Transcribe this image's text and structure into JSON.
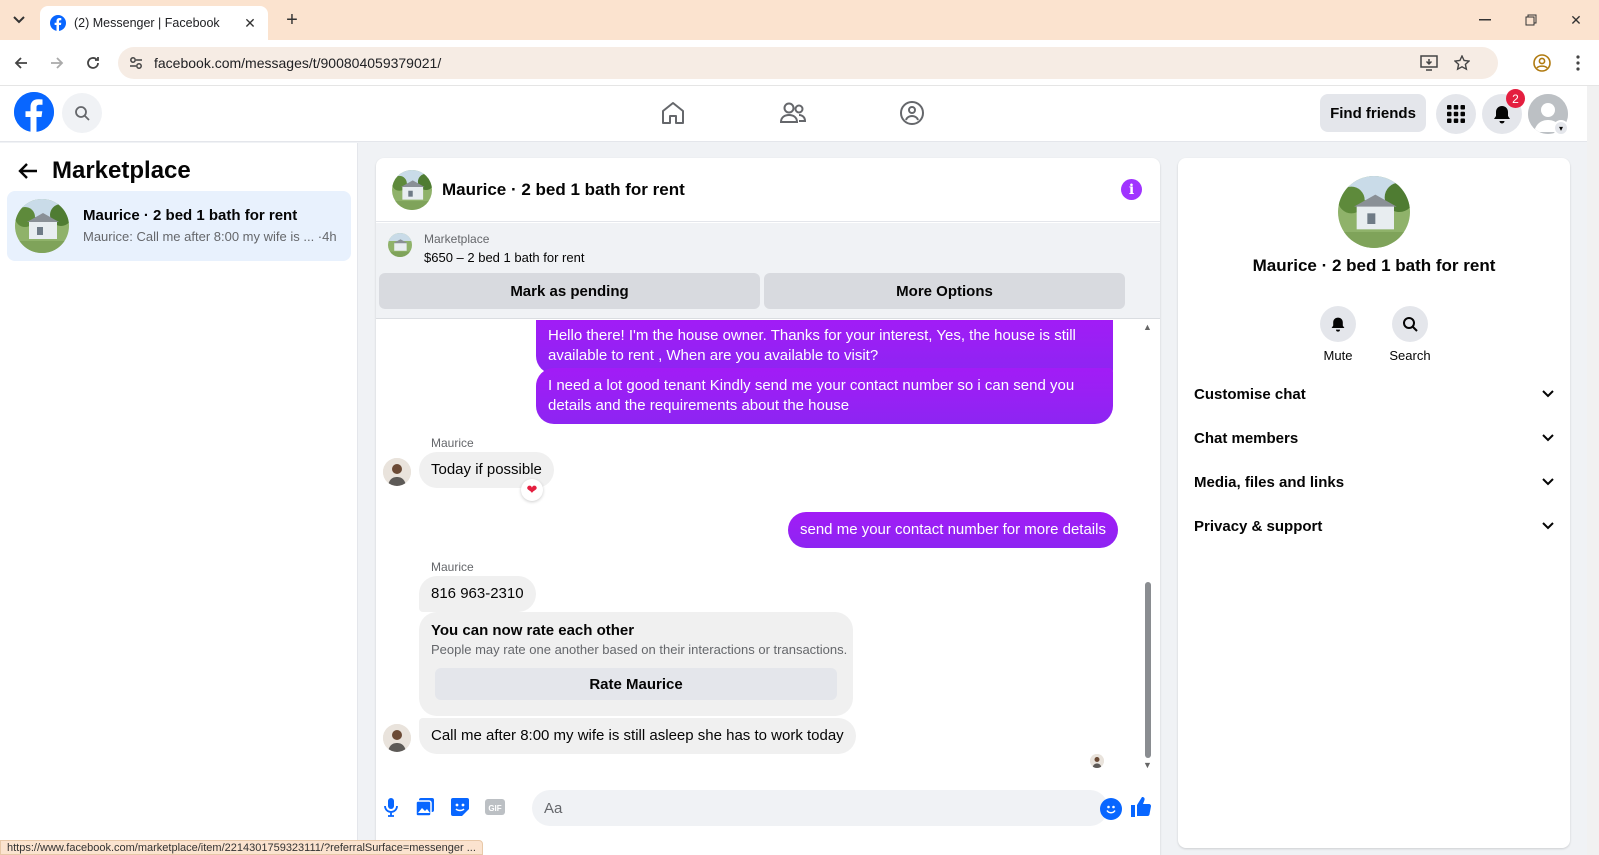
{
  "browser": {
    "tab_title": "(2) Messenger | Facebook",
    "url": "facebook.com/messages/t/900804059379021/",
    "status_url": "https://www.facebook.com/marketplace/item/2214301759323111/?referralSurface=messenger ..."
  },
  "topnav": {
    "find_friends": "Find friends",
    "notification_count": "2"
  },
  "sidebar": {
    "title": "Marketplace",
    "conversation": {
      "name": "Maurice · 2 bed 1 bath for rent",
      "preview": "Maurice: Call me after 8:00 my wife is ... ·4h"
    }
  },
  "chat": {
    "title": "Maurice · 2 bed 1 bath for rent",
    "listing": {
      "label": "Marketplace",
      "price_title": "$650 – 2 bed 1 bath for rent",
      "mark_pending": "Mark as pending",
      "more_options": "More Options"
    },
    "messages": {
      "out1": "Hello there! I'm the house owner. Thanks for your interest, Yes, the house is still available to rent , When are you available to visit?",
      "out2": "I need a lot good tenant Kindly send me your contact number so i can send you details and the requirements about the house",
      "sender1": "Maurice",
      "in1": "Today if possible",
      "reaction": "❤",
      "out3": "send me your contact number for more details",
      "sender2": "Maurice",
      "in2": "816 963-2310",
      "rate_title": "You can now rate each other",
      "rate_sub": "People may rate one another based on their interactions or transactions.",
      "rate_button": "Rate Maurice",
      "in3": "Call me after 8:00 my wife is still asleep she has to work today"
    },
    "composer_placeholder": "Aa"
  },
  "info_panel": {
    "name": "Maurice · 2 bed 1 bath for rent",
    "mute": "Mute",
    "search": "Search",
    "rows": [
      "Customise chat",
      "Chat members",
      "Media, files and links",
      "Privacy & support"
    ]
  },
  "colors": {
    "fb_blue": "#0866ff",
    "outgoing_bubble": "#9b1bf5",
    "notification_red": "#e41e3f"
  }
}
